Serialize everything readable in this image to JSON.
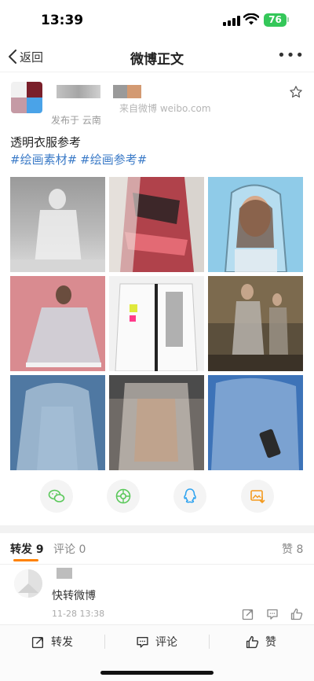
{
  "status": {
    "time": "13:39",
    "battery": "76",
    "icons": [
      "cellular-signal-icon",
      "wifi-icon",
      "battery-icon"
    ]
  },
  "nav": {
    "back_label": "返回",
    "title": "微博正文",
    "more_icon": "more-dots-icon"
  },
  "post": {
    "source": "来自微博 weibo.com",
    "posted_from": "发布于 云南",
    "text": "透明衣服参考",
    "tags": [
      "#绘画素材#",
      "#绘画参考#"
    ],
    "image_count": 9
  },
  "share": {
    "icons": [
      "wechat-icon",
      "moments-icon",
      "qq-icon",
      "save-image-icon"
    ]
  },
  "tabs": {
    "repost": "转发",
    "repost_count": "9",
    "comment": "评论",
    "comment_count": "0",
    "like": "赞",
    "like_count": "8"
  },
  "comment": {
    "text": "快转微博",
    "time": "11-28 13:38"
  },
  "bottom": {
    "repost": "转发",
    "comment": "评论",
    "like": "赞"
  },
  "colors": {
    "link": "#3a7ac7",
    "accent": "#ff8200",
    "battery": "#34c759"
  }
}
